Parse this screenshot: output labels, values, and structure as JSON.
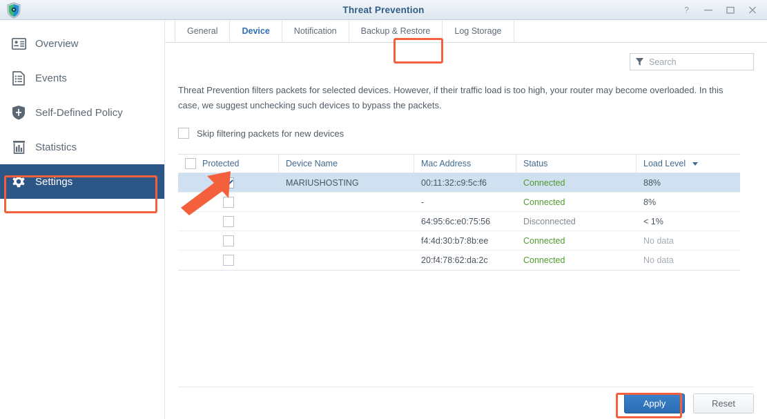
{
  "window": {
    "title": "Threat Prevention",
    "app_icon": "shield-icon",
    "controls": [
      {
        "name": "help-button",
        "glyph": "?"
      },
      {
        "name": "minimize-button",
        "glyph": "─"
      },
      {
        "name": "maximize-button",
        "glyph": "□"
      },
      {
        "name": "close-button",
        "glyph": "✕"
      }
    ]
  },
  "sidebar": {
    "items": [
      {
        "label": "Overview",
        "icon": "id-card-icon",
        "active": false
      },
      {
        "label": "Events",
        "icon": "document-list-icon",
        "active": false
      },
      {
        "label": "Self-Defined Policy",
        "icon": "shield-icon",
        "active": false
      },
      {
        "label": "Statistics",
        "icon": "chart-icon",
        "active": false
      },
      {
        "label": "Settings",
        "icon": "gear-icon",
        "active": true
      }
    ]
  },
  "tabs": [
    {
      "label": "General",
      "active": false
    },
    {
      "label": "Device",
      "active": true
    },
    {
      "label": "Notification",
      "active": false
    },
    {
      "label": "Backup & Restore",
      "active": false
    },
    {
      "label": "Log Storage",
      "active": false
    }
  ],
  "search": {
    "placeholder": "Search",
    "value": "",
    "icon": "filter-icon"
  },
  "description": "Threat Prevention filters packets for selected devices. However, if their traffic load is too high, your router may become overloaded. In this case, we suggest unchecking such devices to bypass the packets.",
  "skip_filtering": {
    "label": "Skip filtering packets for new devices",
    "checked": false
  },
  "table": {
    "columns": [
      {
        "key": "protected",
        "label": "Protected",
        "sorted": false
      },
      {
        "key": "name",
        "label": "Device Name",
        "sorted": false
      },
      {
        "key": "mac",
        "label": "Mac Address",
        "sorted": false
      },
      {
        "key": "status",
        "label": "Status",
        "sorted": false
      },
      {
        "key": "load",
        "label": "Load Level",
        "sorted": true,
        "sort_dir": "desc"
      }
    ],
    "header_checkbox_checked": false,
    "rows": [
      {
        "protected": true,
        "name": "MARIUSHOSTING",
        "mac": "00:11:32:c9:5c:f6",
        "status": "Connected",
        "status_state": "connected",
        "load": "88%",
        "load_state": "value",
        "selected": true
      },
      {
        "protected": false,
        "name": "",
        "mac": "-",
        "status": "Connected",
        "status_state": "connected",
        "load": "8%",
        "load_state": "value",
        "selected": false
      },
      {
        "protected": false,
        "name": "",
        "mac": "64:95:6c:e0:75:56",
        "status": "Disconnected",
        "status_state": "disconnected",
        "load": "< 1%",
        "load_state": "value",
        "selected": false
      },
      {
        "protected": false,
        "name": "",
        "mac": "f4:4d:30:b7:8b:ee",
        "status": "Connected",
        "status_state": "connected",
        "load": "No data",
        "load_state": "nodata",
        "selected": false
      },
      {
        "protected": false,
        "name": "",
        "mac": "20:f4:78:62:da:2c",
        "status": "Connected",
        "status_state": "connected",
        "load": "No data",
        "load_state": "nodata",
        "selected": false
      }
    ]
  },
  "footer": {
    "apply_label": "Apply",
    "reset_label": "Reset"
  },
  "annotations": {
    "highlight_color": "#f4603c",
    "arrow_color": "#f4603c",
    "arrow_target": "protected-checkbox-row-1",
    "highlighted": [
      "sidebar-item-settings",
      "tab-device",
      "apply-button"
    ]
  },
  "colors": {
    "accent": "#2a6cb4",
    "sidebar_active": "#2c5685",
    "row_selected": "#cfe0f0",
    "status_connected": "#4f9a2e",
    "status_disconnected": "#7f8a94",
    "title": "#2f5d85"
  }
}
